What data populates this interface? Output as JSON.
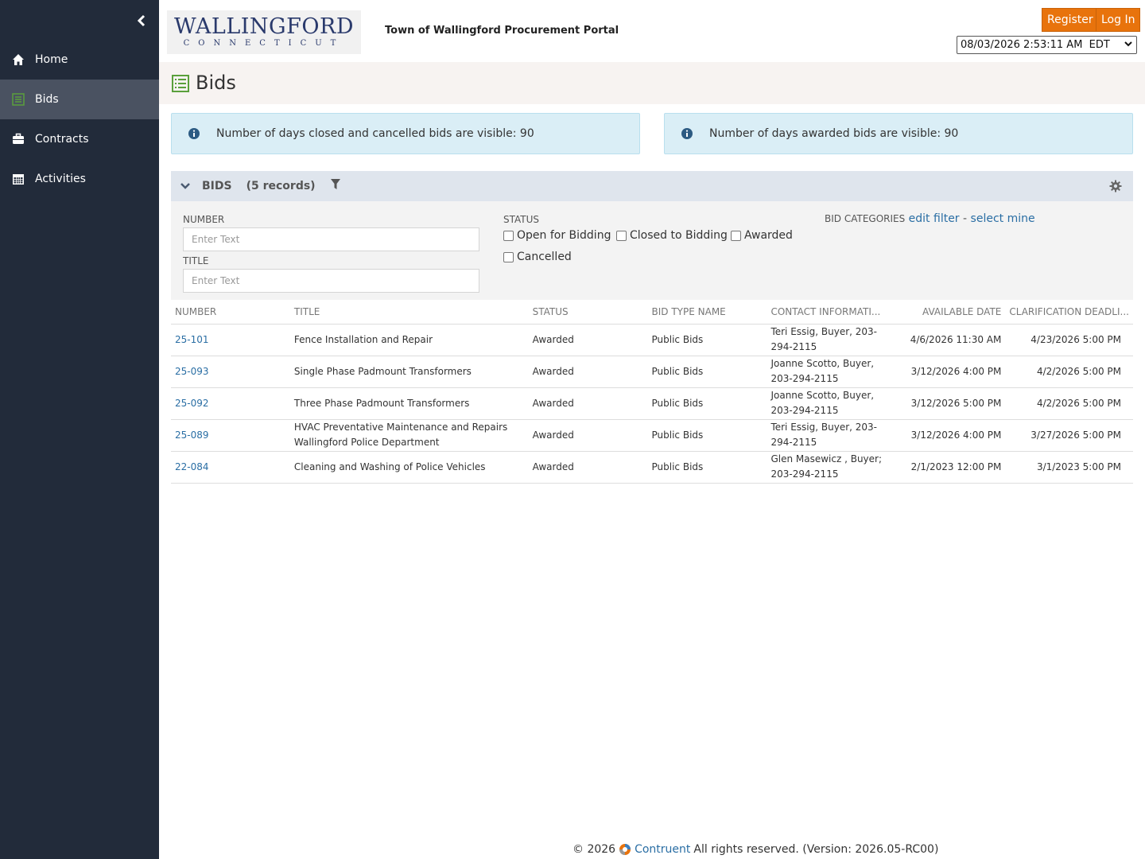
{
  "header": {
    "logo_line1": "WALLINGFORD",
    "logo_line2": "CONNECTICUT",
    "portal_title": "Town of Wallingford Procurement Portal",
    "register_label": "Register",
    "login_label": "Log In",
    "datetime_select": "08/03/2026 2:53:11 AM  EDT"
  },
  "sidebar": {
    "items": [
      {
        "label": "Home",
        "icon": "home-icon"
      },
      {
        "label": "Bids",
        "icon": "list-icon"
      },
      {
        "label": "Contracts",
        "icon": "briefcase-icon"
      },
      {
        "label": "Activities",
        "icon": "calendar-icon"
      }
    ],
    "active": "Bids"
  },
  "page": {
    "title": "Bids"
  },
  "info": {
    "closed_cancelled": "Number of days closed and cancelled bids are visible: 90",
    "awarded": "Number of days awarded bids are visible: 90"
  },
  "panel": {
    "title": "BIDS",
    "records": "(5 records)"
  },
  "filters": {
    "number_label": "NUMBER",
    "number_placeholder": "Enter Text",
    "title_label": "TITLE",
    "title_placeholder": "Enter Text",
    "status_label": "STATUS",
    "status_options": [
      "Open for Bidding",
      "Closed to Bidding",
      "Awarded",
      "Cancelled"
    ],
    "categories_label": "BID CATEGORIES",
    "edit_filter": "edit filter",
    "separator": "-",
    "select_mine": "select mine"
  },
  "table": {
    "columns": [
      "NUMBER",
      "TITLE",
      "STATUS",
      "BID TYPE NAME",
      "CONTACT INFORMATI...",
      "AVAILABLE DATE",
      "CLARIFICATION DEADLI..."
    ],
    "rows": [
      {
        "number": "25-101",
        "title": "Fence Installation and Repair",
        "status": "Awarded",
        "bid_type": "Public Bids",
        "contact": "Teri Essig, Buyer, 203-294-2115",
        "available": "4/6/2026 11:30 AM",
        "deadline": "4/23/2026 5:00 PM"
      },
      {
        "number": "25-093",
        "title": "Single Phase Padmount Transformers",
        "status": "Awarded",
        "bid_type": "Public Bids",
        "contact": "Joanne Scotto, Buyer, 203-294-2115",
        "available": "3/12/2026 4:00 PM",
        "deadline": "4/2/2026 5:00 PM"
      },
      {
        "number": "25-092",
        "title": "Three Phase Padmount Transformers",
        "status": "Awarded",
        "bid_type": "Public Bids",
        "contact": "Joanne Scotto, Buyer, 203-294-2115",
        "available": "3/12/2026 5:00 PM",
        "deadline": "4/2/2026 5:00 PM"
      },
      {
        "number": "25-089",
        "title": "HVAC Preventative Maintenance and Repairs Wallingford Police Department",
        "status": "Awarded",
        "bid_type": "Public Bids",
        "contact": "Teri Essig, Buyer, 203-294-2115",
        "available": "3/12/2026 4:00 PM",
        "deadline": "3/27/2026 5:00 PM"
      },
      {
        "number": "22-084",
        "title": "Cleaning and Washing of Police Vehicles",
        "status": "Awarded",
        "bid_type": "Public Bids",
        "contact": "Glen Masewicz , Buyer; 203-294-2115",
        "available": "2/1/2023 12:00 PM",
        "deadline": "3/1/2023 5:00 PM"
      }
    ]
  },
  "footer": {
    "copyright": "© 2026",
    "brand": "Contruent",
    "rest": "All rights reserved. (Version: 2026.05-RC00)"
  },
  "colors": {
    "sidebar_bg": "#222b3a",
    "sidebar_active": "#4a5261",
    "accent_orange": "#e8730c",
    "link_blue": "#2a6ea4",
    "info_bg": "#daeef6",
    "bids_icon_green": "#5aa03c"
  }
}
